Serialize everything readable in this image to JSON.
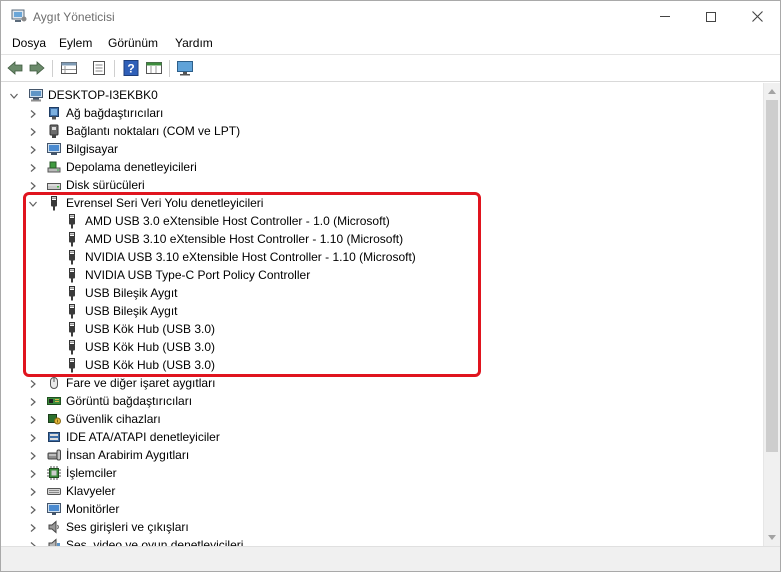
{
  "window": {
    "title": "Aygıt Yöneticisi"
  },
  "menu": [
    "Dosya",
    "Eylem",
    "Görünüm",
    "Yardım"
  ],
  "toolbar": {
    "icons": [
      "back-arrow-icon",
      "forward-arrow-icon",
      "properties-grid-icon",
      "properties-sheet-icon",
      "help-icon",
      "view-grid-icon",
      "monitor-icon"
    ]
  },
  "tree": {
    "root": "DESKTOP-I3EKBK0",
    "items": [
      {
        "label": "Ağ bağdaştırıcıları",
        "icon": "network-adapter-icon"
      },
      {
        "label": "Bağlantı noktaları (COM ve LPT)",
        "icon": "port-icon"
      },
      {
        "label": "Bilgisayar",
        "icon": "computer-icon"
      },
      {
        "label": "Depolama denetleyicileri",
        "icon": "storage-controller-icon"
      },
      {
        "label": "Disk sürücüleri",
        "icon": "disk-drive-icon"
      },
      {
        "label": "Evrensel Seri Veri Yolu denetleyicileri",
        "icon": "usb-icon",
        "expanded": true,
        "children": [
          "AMD USB 3.0 eXtensible Host Controller - 1.0 (Microsoft)",
          "AMD USB 3.10 eXtensible Host Controller - 1.10 (Microsoft)",
          "NVIDIA USB 3.10 eXtensible Host Controller - 1.10 (Microsoft)",
          "NVIDIA USB Type-C Port Policy Controller",
          "USB Bileşik Aygıt",
          "USB Bileşik Aygıt",
          "USB Kök Hub (USB 3.0)",
          "USB Kök Hub (USB 3.0)",
          "USB Kök Hub (USB 3.0)"
        ]
      },
      {
        "label": "Fare ve diğer işaret aygıtları",
        "icon": "mouse-icon"
      },
      {
        "label": "Görüntü bağdaştırıcıları",
        "icon": "display-adapter-icon"
      },
      {
        "label": "Güvenlik cihazları",
        "icon": "security-device-icon"
      },
      {
        "label": "IDE ATA/ATAPI denetleyiciler",
        "icon": "ide-controller-icon"
      },
      {
        "label": "İnsan Arabirim Aygıtları",
        "icon": "hid-icon"
      },
      {
        "label": "İşlemciler",
        "icon": "processor-icon"
      },
      {
        "label": "Klavyeler",
        "icon": "keyboard-icon"
      },
      {
        "label": "Monitörler",
        "icon": "monitor-icon"
      },
      {
        "label": "Ses girişleri ve çıkışları",
        "icon": "audio-io-icon"
      },
      {
        "label": "Ses, video ve oyun denetleyicileri",
        "icon": "sound-video-icon"
      }
    ]
  },
  "colors": {
    "highlight": "#e0141e",
    "title_text": "#6d6d6d"
  }
}
